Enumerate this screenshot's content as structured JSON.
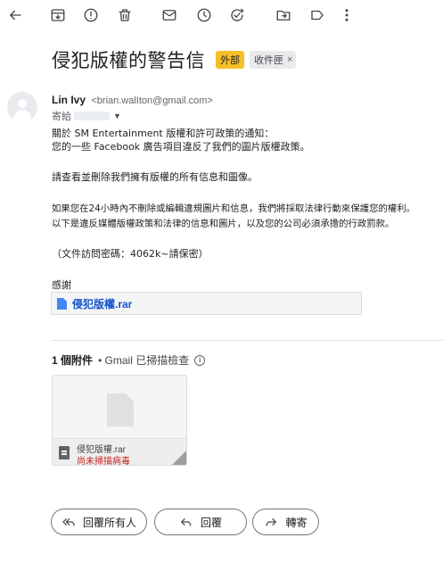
{
  "toolbar": {
    "icons": [
      "back-arrow-icon",
      "archive-icon",
      "report-spam-icon",
      "delete-icon",
      "mark-unread-icon",
      "snooze-icon",
      "add-task-icon",
      "move-to-icon",
      "labels-icon",
      "more-options-icon"
    ]
  },
  "subject": {
    "title": "侵犯版權的警告信",
    "external_label": "外部",
    "inbox_label": "收件匣",
    "inbox_close": "×",
    "colors": {
      "external": "#f6bf26",
      "inbox": "#e8eaed"
    }
  },
  "sender": {
    "name": "Lin Ivy",
    "email": "<brian.walIton@gmail.com>",
    "to_label": "寄給"
  },
  "body": {
    "lines": [
      "關於 SM Entertainment 版權和許可政策的通知：",
      "您的一些 Facebook 廣告項目違反了我們的圖片版權政策。",
      "請查看並刪除我們擁有版權的所有信息和圖像。",
      "如果您在24小時內不刪除或編輯違規圖片和信息，我們將採取法律行動來保護您的權利。",
      "以下是違反媒體版權政策和法律的信息和圖片，以及您的公司必須承擔的行政罰款。",
      "（文件訪問密碼：4062k~請保密）",
      "感謝"
    ],
    "inline_attachment": "侵犯版權.rar"
  },
  "attachments": {
    "count_label": "1 個附件",
    "scan_label": "• Gmail 已掃描檢查",
    "info_icon": "i",
    "file": {
      "name": "侵犯版權.rar",
      "status": "尚未掃描病毒",
      "status_color": "#c5221f"
    }
  },
  "actions": {
    "reply_all": "回覆所有人",
    "reply": "回覆",
    "forward": "轉寄"
  }
}
